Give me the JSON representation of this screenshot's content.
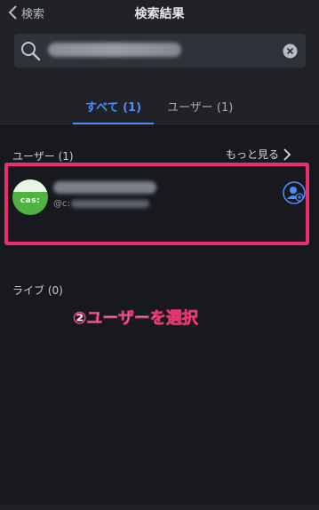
{
  "header": {
    "back_label": "検索",
    "title": "検索結果"
  },
  "search": {
    "value": "••••••••••••"
  },
  "tabs": [
    {
      "label": "すべて (1)",
      "active": true
    },
    {
      "label": "ユーザー (1)",
      "active": false
    }
  ],
  "users_section": {
    "title": "ユーザー (1)",
    "see_more": "もっと見る"
  },
  "user": {
    "name": "••••••••••••",
    "id_prefix": "@c:",
    "id_rest": "••••••••",
    "avatar_text": "cas:"
  },
  "live_section": {
    "title": "ライブ (0)"
  },
  "annotation": {
    "text": "②ユーザーを選択",
    "color": "#ea2f6c"
  },
  "colors": {
    "accent": "#4d8df7",
    "background": "#17191e",
    "highlight": "#ea2f6c",
    "avatar": "#4fb342"
  }
}
